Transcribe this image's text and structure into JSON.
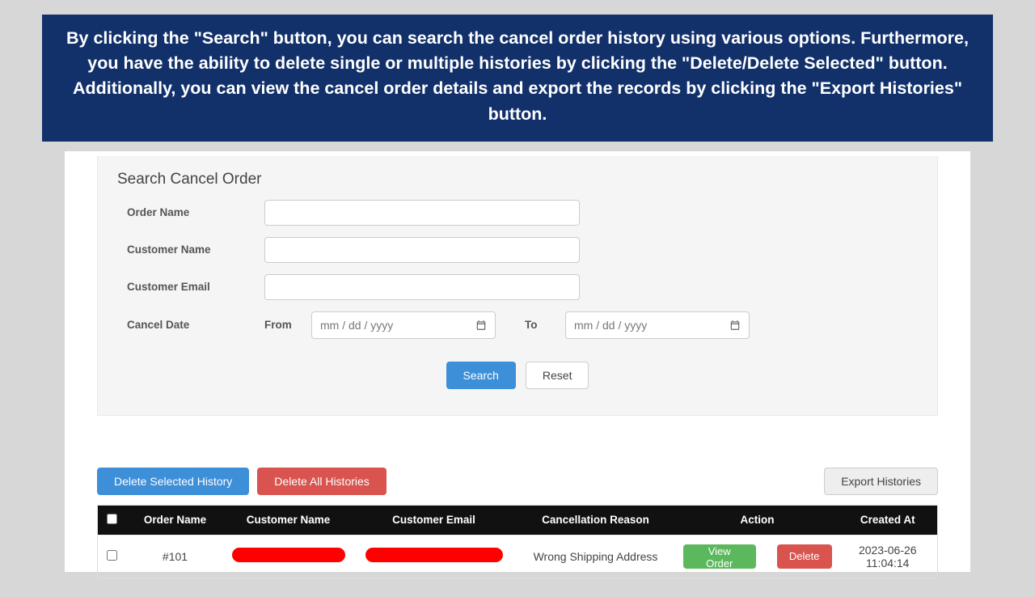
{
  "banner": "By clicking the \"Search\" button, you can search the cancel order history using various options. Furthermore, you have the ability to delete single or multiple histories by clicking the \"Delete/Delete Selected\" button. Additionally, you can view the cancel order details and export the records by clicking the \"Export Histories\" button.",
  "search": {
    "title": "Search Cancel Order",
    "labels": {
      "order_name": "Order Name",
      "customer_name": "Customer Name",
      "customer_email": "Customer Email",
      "cancel_date": "Cancel Date",
      "from": "From",
      "to": "To"
    },
    "date_placeholder": "mm / dd / yyyy",
    "buttons": {
      "search": "Search",
      "reset": "Reset"
    }
  },
  "toolbar": {
    "delete_selected": "Delete Selected History",
    "delete_all": "Delete All Histories",
    "export": "Export Histories"
  },
  "table": {
    "headers": {
      "order_name": "Order Name",
      "customer_name": "Customer Name",
      "customer_email": "Customer Email",
      "reason": "Cancellation Reason",
      "action": "Action",
      "created_at": "Created At"
    },
    "rows": [
      {
        "order_name": "#101",
        "customer_name_redacted": true,
        "customer_email_redacted": true,
        "reason": "Wrong Shipping Address",
        "created_at": "2023-06-26 11:04:14"
      }
    ],
    "row_buttons": {
      "view": "View Order",
      "delete": "Delete"
    }
  }
}
